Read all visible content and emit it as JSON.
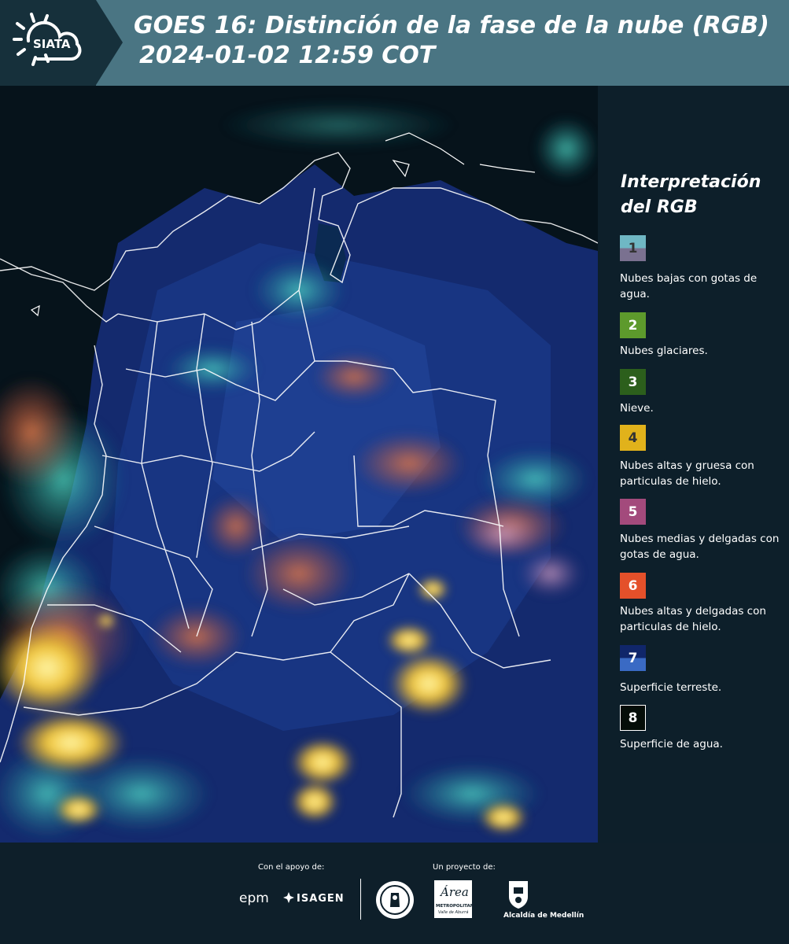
{
  "header": {
    "logo_text": "SIATA",
    "title_line1": "GOES 16: Distinción de la fase de la nube (RGB)",
    "title_line2": "2024-01-02 12:59 COT"
  },
  "legend": {
    "title_line1": "Interpretación",
    "title_line2": "del RGB",
    "items": [
      {
        "num": "1",
        "label": "Nubes bajas con gotas de agua.",
        "color_top": "#6fb7c4",
        "color_bottom": "#7a7190"
      },
      {
        "num": "2",
        "label": "Nubes glaciares.",
        "color_top": "#5d9a2c",
        "color_bottom": "#5d9a2c"
      },
      {
        "num": "3",
        "label": "Nieve.",
        "color_top": "#2c5f1c",
        "color_bottom": "#2c5f1c"
      },
      {
        "num": "4",
        "label": "Nubes altas y gruesa con particulas de hielo.",
        "color_top": "#e1b21b",
        "color_bottom": "#e1b21b"
      },
      {
        "num": "5",
        "label": "Nubes medias y delgadas con gotas de agua.",
        "color_top": "#a34a7c",
        "color_bottom": "#a34a7c"
      },
      {
        "num": "6",
        "label": "Nubes altas y delgadas con particulas de hielo.",
        "color_top": "#e4502a",
        "color_bottom": "#e4502a"
      },
      {
        "num": "7",
        "label": "Superficie terreste.",
        "color_top": "#10266a",
        "color_bottom": "#3a6ac4"
      },
      {
        "num": "8",
        "label": "Superficie de agua.",
        "color_top": "#050d08",
        "color_bottom": "#050d08"
      }
    ]
  },
  "footer": {
    "support_label": "Con el apoyo de:",
    "project_label": "Un proyecto de:",
    "epm": "epm",
    "isagen": "ISAGEN",
    "area_metro_script": "Área",
    "area_metro_line1": "METROPOLITANA",
    "area_metro_line2": "Valle de Aburrá",
    "alcaldia": "Alcaldía de Medellín"
  }
}
